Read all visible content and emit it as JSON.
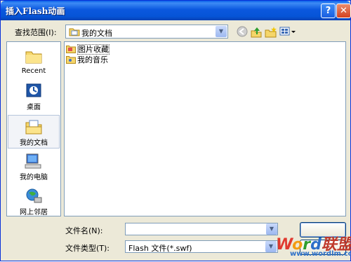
{
  "window": {
    "title": "插入Flash动画",
    "help_label": "?",
    "close_label": "✕"
  },
  "toolbar": {
    "look_in_label": "查找范围(I):",
    "look_in_value": "我的文档",
    "back_icon": "back-arrow-icon",
    "up_icon": "up-folder-icon",
    "new_folder_icon": "new-folder-icon",
    "views_icon": "views-menu-icon"
  },
  "places": [
    {
      "label": "Recent",
      "icon": "recent-folder-icon"
    },
    {
      "label": "桌面",
      "icon": "desktop-icon"
    },
    {
      "label": "我的文档",
      "icon": "my-documents-icon",
      "selected": true
    },
    {
      "label": "我的电脑",
      "icon": "my-computer-icon"
    },
    {
      "label": "网上邻居",
      "icon": "network-places-icon"
    }
  ],
  "files": [
    {
      "name": "图片收藏",
      "icon": "folder-icon",
      "selected": true
    },
    {
      "name": "我的音乐",
      "icon": "folder-icon",
      "selected": false
    }
  ],
  "form": {
    "filename_label": "文件名(N):",
    "filename_value": "",
    "filetype_label": "文件类型(T):",
    "filetype_value": "Flash 文件(*.swf)"
  },
  "buttons": {
    "open_label": "",
    "cancel_label": ""
  },
  "watermark": {
    "text": "Word联盟",
    "subtext": "www.wordlm.com"
  }
}
